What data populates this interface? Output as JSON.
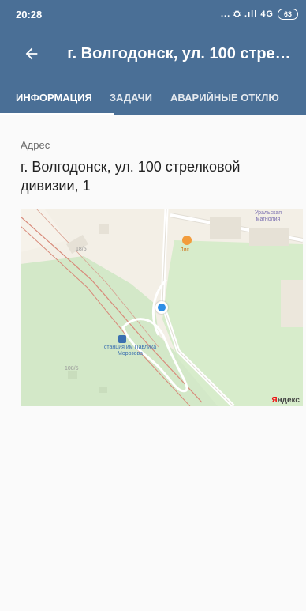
{
  "status_bar": {
    "time": "20:28",
    "indicators": "... ⛭ .ıll 4G",
    "battery": "63"
  },
  "toolbar": {
    "back_icon": "arrow-left-icon",
    "title": "г. Волгодонск, ул. 100 стрел..."
  },
  "tabs": [
    {
      "label": "ИНФОРМАЦИЯ",
      "active": true
    },
    {
      "label": "ЗАДАЧИ",
      "active": false
    },
    {
      "label": "АВАРИЙНЫЕ ОТКЛЮ",
      "active": false
    }
  ],
  "address": {
    "label": "Адрес",
    "value": "г. Волгодонск, ул. 100 стрелковой дивизии, 1"
  },
  "map": {
    "labels": {
      "station": "станция им Павлика Морозова",
      "poi_top": "Уральская магнолия",
      "poi_food": "Лис",
      "house_a": "18/5",
      "house_b": "108/5"
    },
    "provider_prefix": "Я",
    "provider_rest": "ндекс"
  },
  "colors": {
    "appbar": "#4a6f96",
    "map_green": "#d3e8c8",
    "map_land": "#f3efe6",
    "location_marker": "#2d8ee6"
  }
}
